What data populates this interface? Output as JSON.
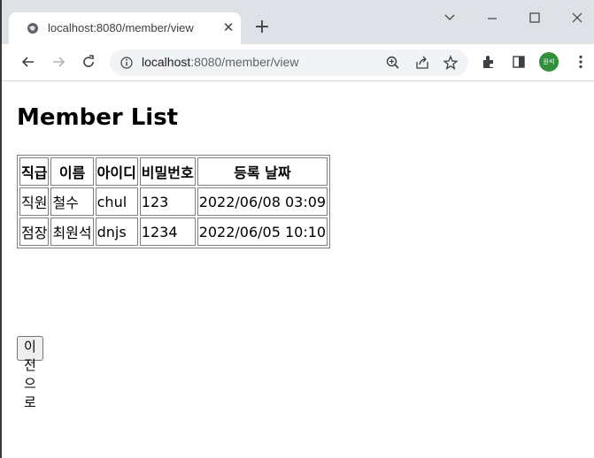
{
  "browser": {
    "tab_title": "localhost:8080/member/view",
    "url_host": "localhost",
    "url_path": ":8080/member/view",
    "profile_label": "원석",
    "profile_color": "#2f8f3a"
  },
  "page": {
    "heading": "Member List",
    "table": {
      "headers": [
        "직급",
        "이름",
        "아이디",
        "비밀번호",
        "등록 날짜"
      ],
      "rows": [
        [
          "직원",
          "철수",
          "chul",
          "123",
          "2022/06/08 03:09"
        ],
        [
          "점장",
          "최원석",
          "dnjs",
          "1234",
          "2022/06/05 10:10"
        ]
      ]
    },
    "back_button_label": "이전으로"
  },
  "icons": [
    "globe-icon",
    "close-icon",
    "plus-icon",
    "chevron-down-icon",
    "minimize-icon",
    "maximize-icon",
    "window-close-icon",
    "back-arrow-icon",
    "forward-arrow-icon",
    "reload-icon",
    "info-icon",
    "zoom-icon",
    "share-icon",
    "bookmark-star-icon",
    "extensions-icon",
    "side-panel-icon",
    "more-menu-icon"
  ]
}
